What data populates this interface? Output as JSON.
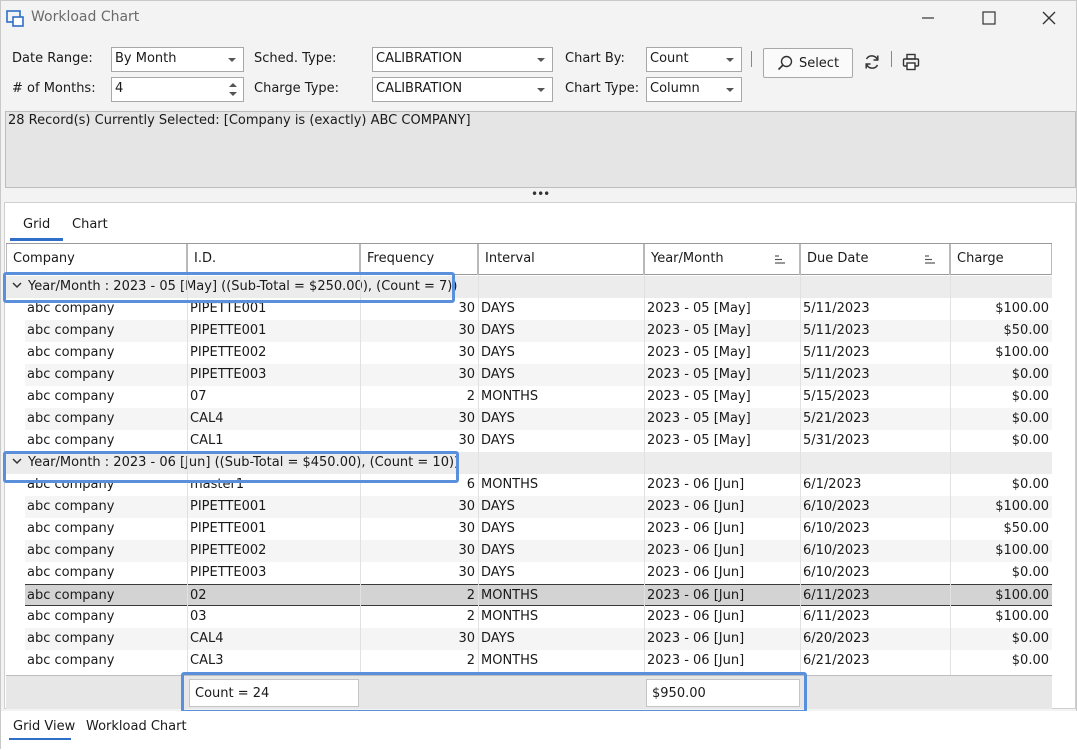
{
  "window": {
    "title": "Workload Chart"
  },
  "toolbar": {
    "date_range_label": "Date Range:",
    "date_range_value": "By Month",
    "sched_type_label": "Sched. Type:",
    "sched_type_value": "CALIBRATION",
    "chart_by_label": "Chart By:",
    "chart_by_value": "Count",
    "months_label": "# of Months:",
    "months_value": "4",
    "charge_type_label": "Charge Type:",
    "charge_type_value": "CALIBRATION",
    "chart_type_label": "Chart Type:",
    "chart_type_value": "Column",
    "select_label": "Select"
  },
  "filter": {
    "text": "28 Record(s) Currently Selected: [Company is (exactly) ABC COMPANY]"
  },
  "tabs": [
    {
      "label": "Grid"
    },
    {
      "label": "Chart"
    }
  ],
  "columns": [
    "Company",
    "I.D.",
    "Frequency",
    "Interval",
    "Year/Month",
    "Due Date",
    "Charge"
  ],
  "groups": [
    {
      "label": "Year/Month : 2023 - 05 [May] ((Sub-Total = $250.00), (Count = 7))",
      "rows": [
        [
          "abc company",
          "PIPETTE001",
          "30",
          "DAYS",
          "2023 - 05 [May]",
          "5/11/2023",
          "$100.00"
        ],
        [
          "abc company",
          "PIPETTE001",
          "30",
          "DAYS",
          "2023 - 05 [May]",
          "5/11/2023",
          "$50.00"
        ],
        [
          "abc company",
          "PIPETTE002",
          "30",
          "DAYS",
          "2023 - 05 [May]",
          "5/11/2023",
          "$100.00"
        ],
        [
          "abc company",
          "PIPETTE003",
          "30",
          "DAYS",
          "2023 - 05 [May]",
          "5/11/2023",
          "$0.00"
        ],
        [
          "abc company",
          "07",
          "2",
          "MONTHS",
          "2023 - 05 [May]",
          "5/15/2023",
          "$0.00"
        ],
        [
          "abc company",
          "CAL4",
          "30",
          "DAYS",
          "2023 - 05 [May]",
          "5/21/2023",
          "$0.00"
        ],
        [
          "abc company",
          "CAL1",
          "30",
          "DAYS",
          "2023 - 05 [May]",
          "5/31/2023",
          "$0.00"
        ]
      ]
    },
    {
      "label": "Year/Month : 2023 - 06 [Jun] ((Sub-Total = $450.00), (Count = 10))",
      "rows": [
        [
          "abc company",
          "master1",
          "6",
          "MONTHS",
          "2023 - 06 [Jun]",
          "6/1/2023",
          "$0.00"
        ],
        [
          "abc company",
          "PIPETTE001",
          "30",
          "DAYS",
          "2023 - 06 [Jun]",
          "6/10/2023",
          "$100.00"
        ],
        [
          "abc company",
          "PIPETTE001",
          "30",
          "DAYS",
          "2023 - 06 [Jun]",
          "6/10/2023",
          "$50.00"
        ],
        [
          "abc company",
          "PIPETTE002",
          "30",
          "DAYS",
          "2023 - 06 [Jun]",
          "6/10/2023",
          "$100.00"
        ],
        [
          "abc company",
          "PIPETTE003",
          "30",
          "DAYS",
          "2023 - 06 [Jun]",
          "6/10/2023",
          "$0.00"
        ],
        [
          "abc company",
          "02",
          "2",
          "MONTHS",
          "2023 - 06 [Jun]",
          "6/11/2023",
          "$100.00"
        ],
        [
          "abc company",
          "03",
          "2",
          "MONTHS",
          "2023 - 06 [Jun]",
          "6/11/2023",
          "$100.00"
        ],
        [
          "abc company",
          "CAL4",
          "30",
          "DAYS",
          "2023 - 06 [Jun]",
          "6/20/2023",
          "$0.00"
        ],
        [
          "abc company",
          "CAL3",
          "2",
          "MONTHS",
          "2023 - 06 [Jun]",
          "6/21/2023",
          "$0.00"
        ]
      ]
    }
  ],
  "footer": {
    "count": "Count = 24",
    "total": "$950.00"
  },
  "bottom_tabs": [
    {
      "label": "Grid View"
    },
    {
      "label": "Workload Chart"
    }
  ],
  "colors": {
    "accent": "#2f6fc7",
    "highlight": "#5a8fdc",
    "selected_row": "#d3d3d3"
  }
}
